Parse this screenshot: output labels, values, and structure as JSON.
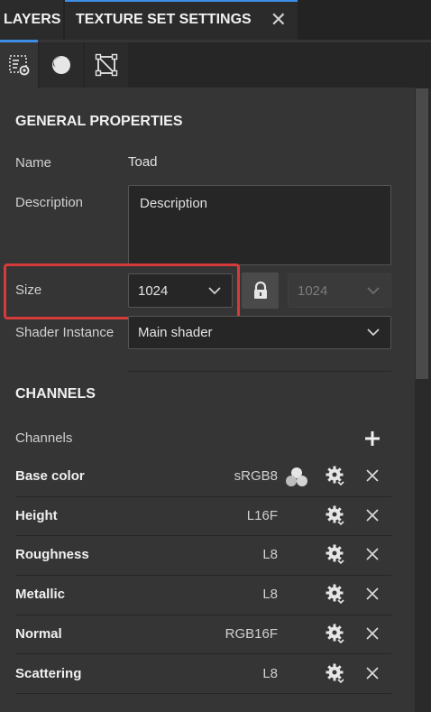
{
  "tabs": {
    "layers": "LAYERS",
    "texture_set_settings": "TEXTURE SET SETTINGS",
    "close_glyph": "✕"
  },
  "subtabs": [
    {
      "icon": "texture-settings-icon",
      "active": true
    },
    {
      "icon": "shader-sphere-icon",
      "active": false
    },
    {
      "icon": "uv-mesh-icon",
      "active": false
    }
  ],
  "general": {
    "title": "GENERAL PROPERTIES",
    "name_label": "Name",
    "name_value": "Toad",
    "description_label": "Description",
    "description_value": "Description",
    "size_label": "Size",
    "size_value": "1024",
    "size_linked_value": "1024",
    "shader_label": "Shader Instance",
    "shader_value": "Main shader"
  },
  "channels": {
    "title": "CHANNELS",
    "list_label": "Channels",
    "rows": [
      {
        "name": "Base color",
        "format": "sRGB8",
        "has_color_icon": true
      },
      {
        "name": "Height",
        "format": "L16F",
        "has_color_icon": false
      },
      {
        "name": "Roughness",
        "format": "L8",
        "has_color_icon": false
      },
      {
        "name": "Metallic",
        "format": "L8",
        "has_color_icon": false
      },
      {
        "name": "Normal",
        "format": "RGB16F",
        "has_color_icon": false
      },
      {
        "name": "Scattering",
        "format": "L8",
        "has_color_icon": false
      }
    ]
  },
  "colors": {
    "accent": "#3d8ee6",
    "highlight": "#d63b3b",
    "panel": "#353535"
  }
}
